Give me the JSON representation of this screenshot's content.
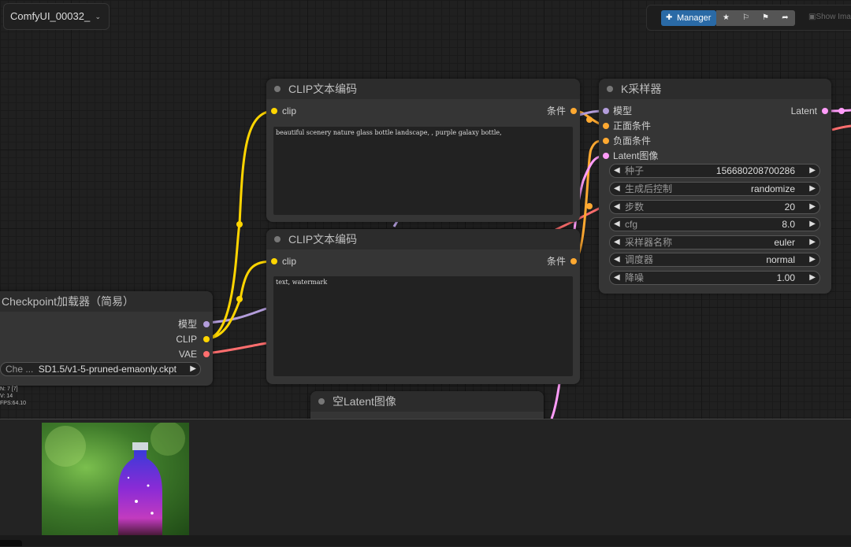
{
  "workflow": {
    "name": "ComfyUI_00032_",
    "dropdown_icon": "chevron-down-icon"
  },
  "menu": {
    "manager_label": "Manager",
    "icons": [
      "star-icon",
      "share-icon",
      "share-alt-icon",
      "arrow-icon"
    ],
    "show_image_label": "Show Ima"
  },
  "nodes": {
    "clip_pos": {
      "title": "CLIP文本编码",
      "input": "clip",
      "output": "条件",
      "text": "beautiful scenery nature glass bottle landscape, , purple galaxy bottle,"
    },
    "clip_neg": {
      "title": "CLIP文本编码",
      "input": "clip",
      "output": "条件",
      "text": "text, watermark"
    },
    "ksampler": {
      "title": "K采样器",
      "inputs": [
        "模型",
        "正面条件",
        "负面条件",
        "Latent图像"
      ],
      "output": "Latent",
      "widgets": [
        {
          "label": "种子",
          "value": "156680208700286"
        },
        {
          "label": "生成后控制",
          "value": "randomize"
        },
        {
          "label": "步数",
          "value": "20"
        },
        {
          "label": "cfg",
          "value": "8.0"
        },
        {
          "label": "采样器名称",
          "value": "euler"
        },
        {
          "label": "调度器",
          "value": "normal"
        },
        {
          "label": "降噪",
          "value": "1.00"
        }
      ]
    },
    "checkpoint": {
      "title": "Checkpoint加载器（简易）",
      "outputs": [
        "模型",
        "CLIP",
        "VAE"
      ],
      "ckpt_label": "Che ...",
      "ckpt_value": "SD1.5/v1-5-pruned-emaonly.ckpt"
    },
    "empty_latent": {
      "title": "空Latent图像"
    }
  },
  "stats": [
    "N: 7 [7]",
    "V: 14",
    "FPS:64.10"
  ],
  "colors": {
    "model": "#b39ddb",
    "clip": "#ffd500",
    "conditioning": "#ffa931",
    "latent": "#ff9cf9",
    "vae": "#ff6e6e",
    "manager": "#2a6aa6"
  }
}
